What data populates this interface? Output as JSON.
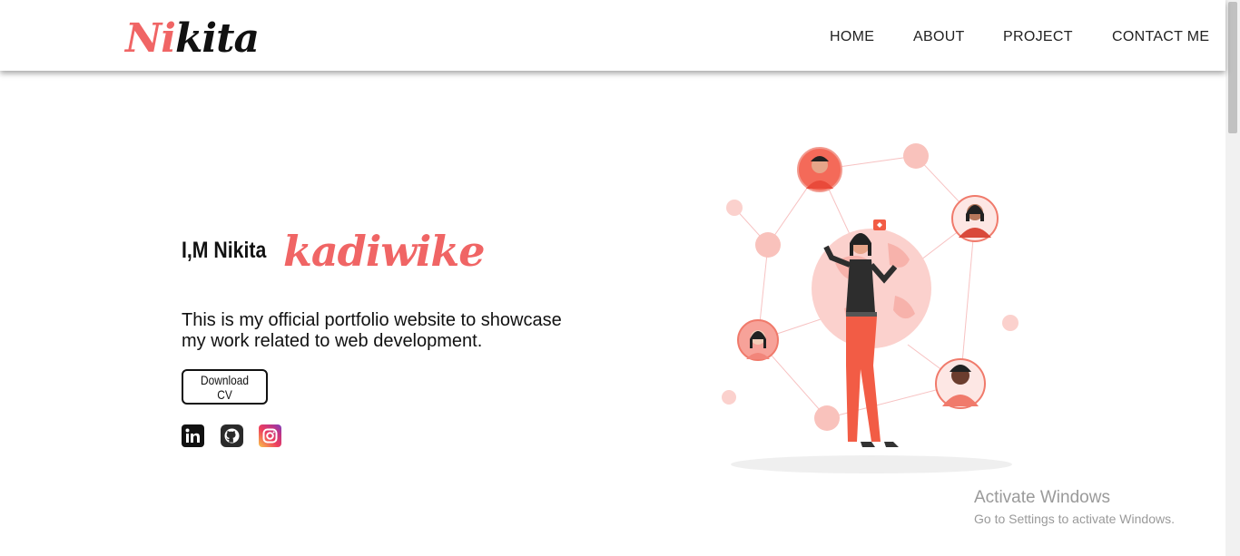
{
  "header": {
    "logo_part1": "Ni",
    "logo_part2": "kita",
    "nav": [
      "HOME",
      "ABOUT",
      "PROJECT",
      "CONTACT ME"
    ]
  },
  "hero": {
    "greeting": "I,M Nikita",
    "surname": "kadiwike",
    "description": "This is my official portfolio website to showcase my work related to web development.",
    "cta_label": "Download CV",
    "social_icons": [
      "linkedin-icon",
      "github-icon",
      "instagram-icon"
    ]
  },
  "colors": {
    "accent": "#f06565",
    "text": "#111111"
  },
  "watermark": {
    "title": "Activate Windows",
    "subtitle": "Go to Settings to activate Windows."
  }
}
